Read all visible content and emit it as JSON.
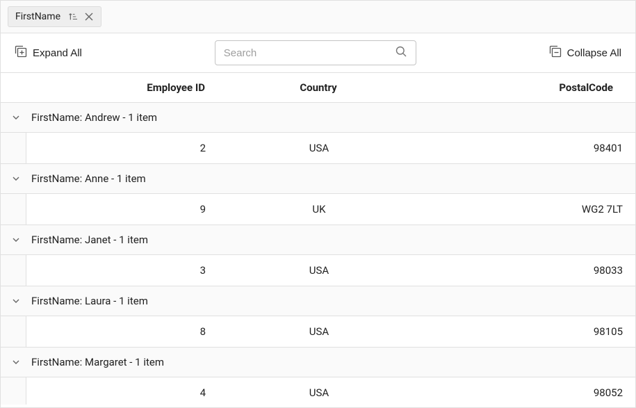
{
  "groupPanel": {
    "chipLabel": "FirstName"
  },
  "toolbar": {
    "expandAll": "Expand All",
    "collapseAll": "Collapse All",
    "searchPlaceholder": "Search"
  },
  "columns": {
    "employeeId": "Employee ID",
    "country": "Country",
    "postalCode": "PostalCode"
  },
  "groups": [
    {
      "header": "FirstName: Andrew - 1 item",
      "rows": [
        {
          "employeeId": "2",
          "country": "USA",
          "postalCode": "98401"
        }
      ]
    },
    {
      "header": "FirstName: Anne - 1 item",
      "rows": [
        {
          "employeeId": "9",
          "country": "UK",
          "postalCode": "WG2 7LT"
        }
      ]
    },
    {
      "header": "FirstName: Janet - 1 item",
      "rows": [
        {
          "employeeId": "3",
          "country": "USA",
          "postalCode": "98033"
        }
      ]
    },
    {
      "header": "FirstName: Laura - 1 item",
      "rows": [
        {
          "employeeId": "8",
          "country": "USA",
          "postalCode": "98105"
        }
      ]
    },
    {
      "header": "FirstName: Margaret - 1 item",
      "rows": [
        {
          "employeeId": "4",
          "country": "USA",
          "postalCode": "98052"
        }
      ]
    }
  ]
}
